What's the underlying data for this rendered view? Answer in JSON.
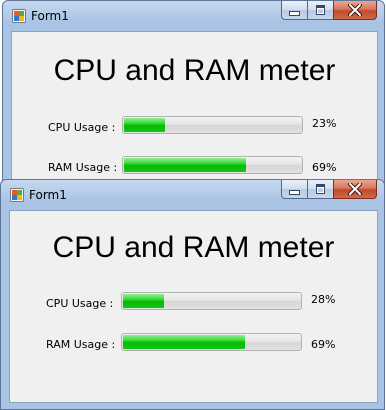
{
  "windows": [
    {
      "title": "Form1",
      "heading": "CPU and RAM meter",
      "cpu_label": "CPU Usage :",
      "cpu_percent_text": "23%",
      "cpu_value": 0.23,
      "ram_label": "RAM Usage :",
      "ram_percent_text": "69%",
      "ram_value": 0.69
    },
    {
      "title": "Form1",
      "heading": "CPU and RAM meter",
      "cpu_label": "CPU Usage :",
      "cpu_percent_text": "28%",
      "cpu_value": 0.23,
      "ram_label": "RAM Usage :",
      "ram_percent_text": "69%",
      "ram_value": 0.69
    }
  ],
  "icons": {
    "app": "windows-form-icon",
    "minimize": "minimize-icon",
    "maximize": "maximize-icon",
    "close": "close-icon"
  },
  "colors": {
    "progress_fill": "#06b906",
    "close_button": "#c14a2e",
    "titlebar": "#b6cde9"
  }
}
